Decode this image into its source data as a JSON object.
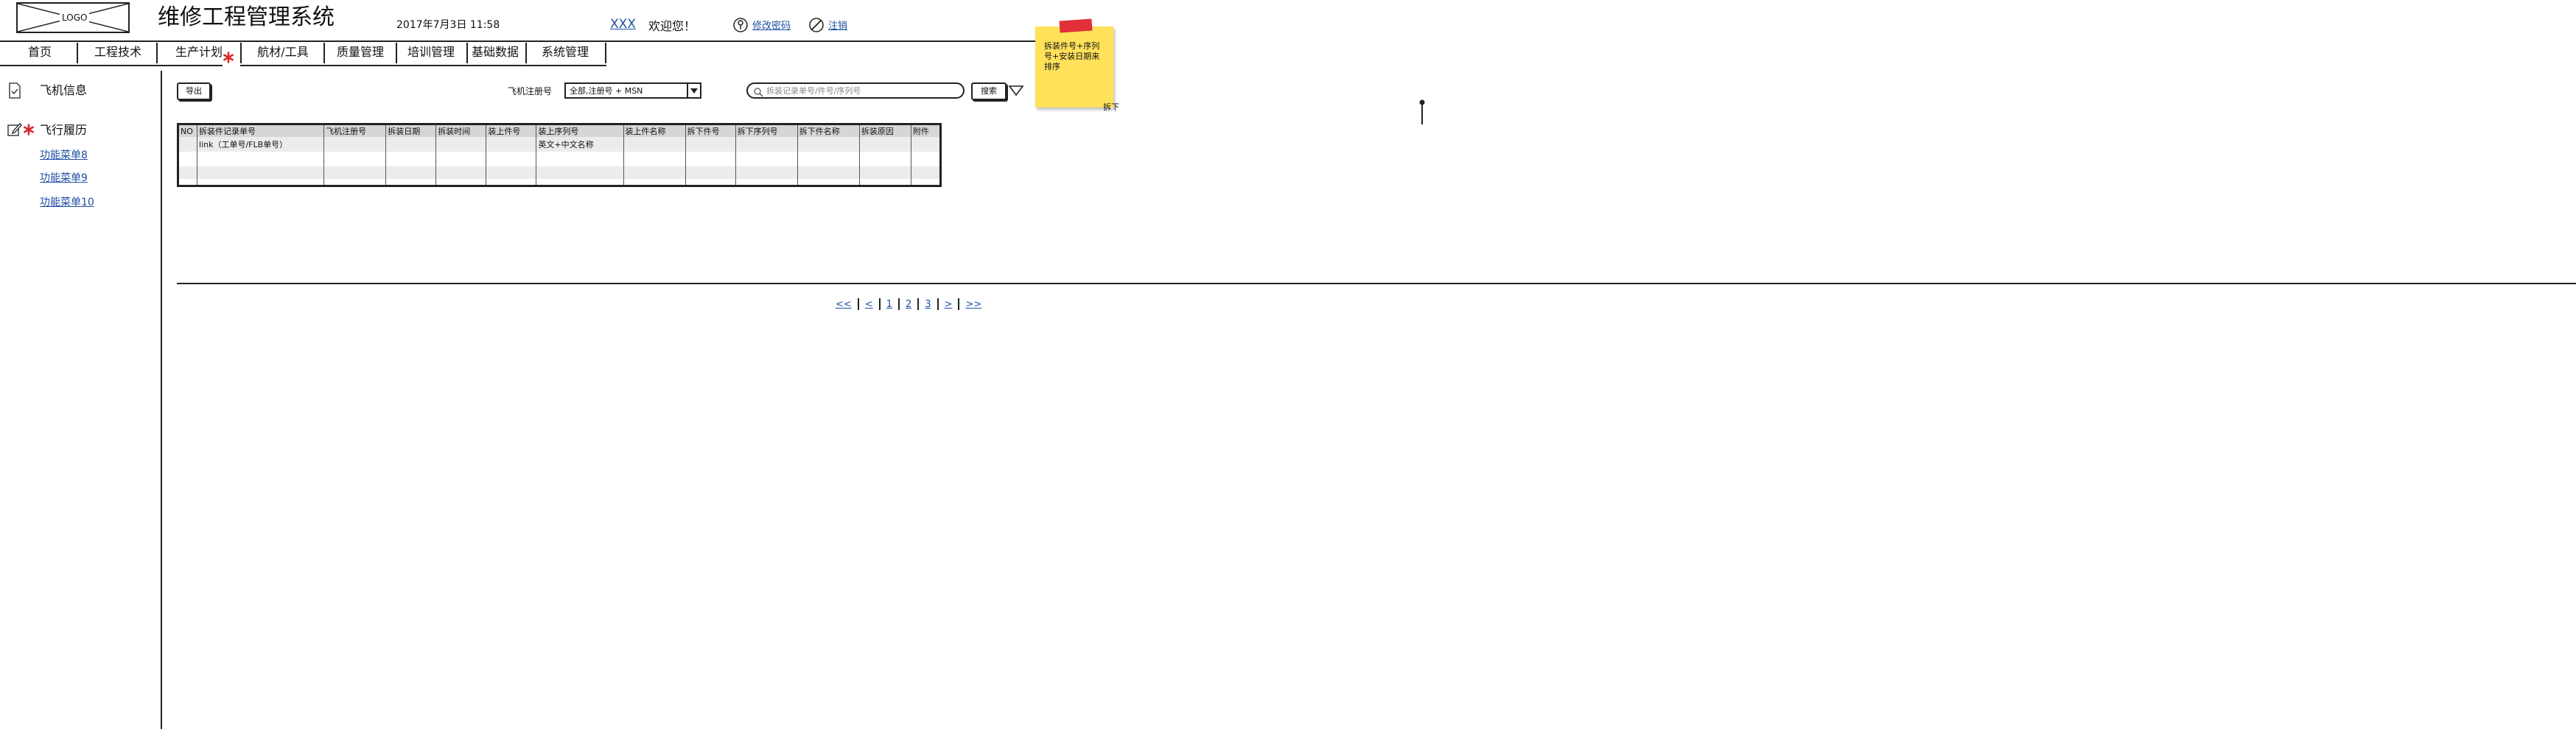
{
  "header": {
    "logo_text": "LOGO",
    "app_title": "维修工程管理系统",
    "datetime": "2017年7月3日  11:58",
    "username": "XXX",
    "welcome": "欢迎您！",
    "change_password": "修改密码",
    "logout": "注销"
  },
  "nav": {
    "items": [
      "首页",
      "工程技术",
      "生产计划",
      "航材/工具",
      "质量管理",
      "培训管理",
      "基础数据",
      "系统管理"
    ]
  },
  "sidebar": {
    "section1": "飞机信息",
    "section2": "飞行履历",
    "items": [
      "功能菜单8",
      "功能菜单9",
      "功能菜单10"
    ]
  },
  "toolbar": {
    "export_label": "导出",
    "filter_label": "飞机注册号",
    "filter_value": "全部,注册号 + MSN",
    "search_placeholder": "拆装记录单号/件号/序列号",
    "search_button": "搜索"
  },
  "note": {
    "text": "拆装件号+序列号+安装日期来排序",
    "tag": "拆下"
  },
  "table": {
    "columns": [
      "NO",
      "拆装件记录单号",
      "飞机注册号",
      "拆装日期",
      "拆装时间",
      "装上件号",
      "装上序列号",
      "装上件名称",
      "拆下件号",
      "拆下序列号",
      "拆下件名称",
      "拆装原因",
      "附件"
    ],
    "rows": [
      [
        "",
        "link（工单号/FLB单号）",
        "",
        "",
        "",
        "",
        "英文+中文名称",
        "",
        "",
        "",
        "",
        "",
        ""
      ]
    ]
  },
  "pagination": {
    "items": [
      "<<",
      "<",
      "1",
      "2",
      "3",
      ">",
      ">>"
    ]
  },
  "colors": {
    "note_bg": "#ffe15a",
    "note_tab": "#e0313a",
    "asterisk": "#d8282b",
    "link": "#1f4fa3"
  }
}
